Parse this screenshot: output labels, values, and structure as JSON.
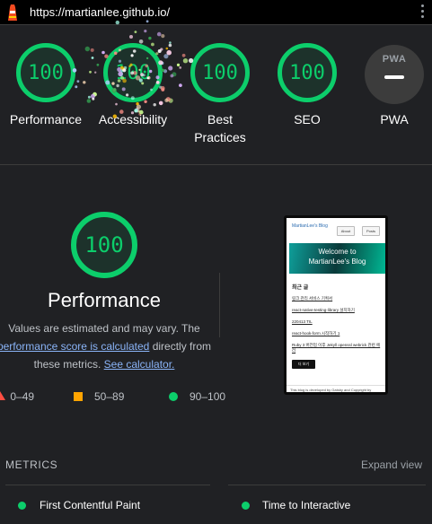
{
  "url_bar": {
    "url": "https://martianlee.github.io/"
  },
  "gauges": [
    {
      "score": "100",
      "label": "Performance"
    },
    {
      "score": "100",
      "label": "Accessibility"
    },
    {
      "score": "100",
      "label": "Best Practices"
    },
    {
      "score": "100",
      "label": "SEO"
    }
  ],
  "pwa": {
    "badge_text": "PWA",
    "label": "PWA"
  },
  "performance": {
    "score": "100",
    "title": "Performance",
    "desc_1": "Values are estimated and may vary. The",
    "desc_link_1": "performance score is calculated",
    "desc_2": "directly from",
    "desc_3": "these metrics.",
    "desc_link_2": "See calculator."
  },
  "legend": {
    "fail": "0–49",
    "average": "50–89",
    "pass": "90–100"
  },
  "screenshot": {
    "brand": "MartianLee's Blog",
    "nav_about": "About",
    "nav_posts": "Posts",
    "banner_line1": "Welcome to",
    "banner_line2": "MartianLee's Blog",
    "recent_heading": "최근 글",
    "posts": [
      "링크 관리 서비스 기획서",
      "react-native-testing-library 설치하기",
      "220413 TIL",
      "react-hook-form 시작하기 1",
      "Ruby 3 버전업 이후 Jekyll openssl webrick 관련 에러"
    ],
    "more_button": "더 보기",
    "footer": "This blog is developed by Gatsby and Copyright by"
  },
  "metrics": {
    "title": "METRICS",
    "expand": "Expand view",
    "items": [
      {
        "name": "First Contentful Paint"
      },
      {
        "name": "Time to Interactive"
      }
    ]
  },
  "colors": {
    "pass": "#0cce6b",
    "average": "#ffa400",
    "fail": "#ff4e42",
    "background": "#202124",
    "link": "#8ab4f8"
  },
  "icons": [
    "lighthouse-logo-icon",
    "kebab-menu-icon",
    "pwa-badge-icon"
  ]
}
